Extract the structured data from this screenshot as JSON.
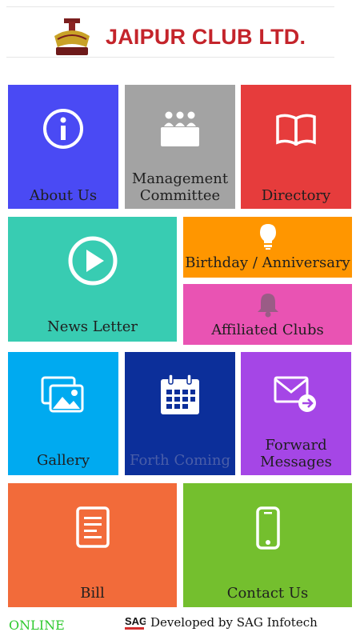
{
  "header": {
    "brand": "JAIPUR CLUB LTD.",
    "logo_icon": "club-crest-logo"
  },
  "tiles": {
    "about": {
      "label": "About Us",
      "icon": "info-icon",
      "color": "#4a4af4"
    },
    "management": {
      "label_line1": "Management",
      "label_line2": "Committee",
      "icon": "committee-icon",
      "color": "#a3a3a3"
    },
    "directory": {
      "label": "Directory",
      "icon": "book-icon",
      "color": "#e63c3c"
    },
    "newsletter": {
      "label": "News Letter",
      "icon": "play-icon",
      "color": "#38ccb2"
    },
    "birthday": {
      "label": "Birthday / Anniversary",
      "icon": "bulb-icon",
      "color": "#ff9600"
    },
    "affiliated": {
      "label": "Affiliated Clubs",
      "icon": "bell-icon",
      "color": "#e953b3"
    },
    "gallery": {
      "label": "Gallery",
      "icon": "photos-icon",
      "color": "#00aaf0"
    },
    "forthcoming": {
      "label": "Forth Coming",
      "icon": "calendar-icon",
      "color": "#0c2f9a"
    },
    "forward": {
      "label_line1": "Forward",
      "label_line2": "Messages",
      "icon": "mail-forward-icon",
      "color": "#a546e6"
    },
    "bill": {
      "label": "Bill",
      "icon": "document-icon",
      "color": "#f26b3a"
    },
    "contact": {
      "label": "Contact Us",
      "icon": "phone-icon",
      "color": "#74bf2e"
    }
  },
  "footer": {
    "status": "ONLINE",
    "dev_logo": "SAG",
    "developer": "Developed by SAG Infotech"
  }
}
